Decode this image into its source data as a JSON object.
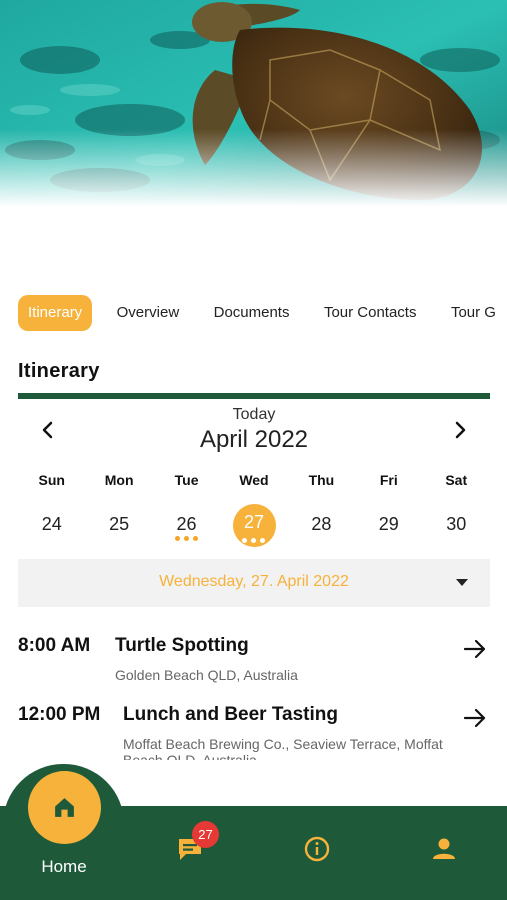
{
  "hero": {
    "image": "sea-turtle-underwater-photo"
  },
  "tabs": [
    {
      "label": "Itinerary",
      "active": true
    },
    {
      "label": "Overview",
      "active": false
    },
    {
      "label": "Documents",
      "active": false
    },
    {
      "label": "Tour Contacts",
      "active": false
    },
    {
      "label": "Tour G",
      "active": false
    }
  ],
  "section": {
    "title": "Itinerary"
  },
  "calendar": {
    "today_label": "Today",
    "month_label": "April 2022",
    "prev_icon": "chevron-left-icon",
    "next_icon": "chevron-right-icon",
    "weekdays": [
      "Sun",
      "Mon",
      "Tue",
      "Wed",
      "Thu",
      "Fri",
      "Sat"
    ],
    "days": [
      {
        "num": "24",
        "events": 0,
        "selected": false
      },
      {
        "num": "25",
        "events": 0,
        "selected": false
      },
      {
        "num": "26",
        "events": 3,
        "selected": false
      },
      {
        "num": "27",
        "events": 3,
        "selected": true
      },
      {
        "num": "28",
        "events": 0,
        "selected": false
      },
      {
        "num": "29",
        "events": 0,
        "selected": false
      },
      {
        "num": "30",
        "events": 0,
        "selected": false
      }
    ],
    "selected_date_label": "Wednesday, 27. April 2022"
  },
  "events": [
    {
      "time": "8:00 AM",
      "title": "Turtle Spotting",
      "location": "Golden Beach QLD, Australia"
    },
    {
      "time": "12:00 PM",
      "title": "Lunch and Beer Tasting",
      "location": "Moffat Beach Brewing Co., Seaview Terrace, Moffat Beach QLD, Australia"
    }
  ],
  "bottom_nav": {
    "home_label": "Home",
    "messages_badge": "27",
    "icons": [
      "home-icon",
      "chat-icon",
      "info-icon",
      "person-icon"
    ]
  },
  "colors": {
    "accent": "#f6b23a",
    "primary_green": "#1e5a3a",
    "badge_red": "#e53935"
  }
}
